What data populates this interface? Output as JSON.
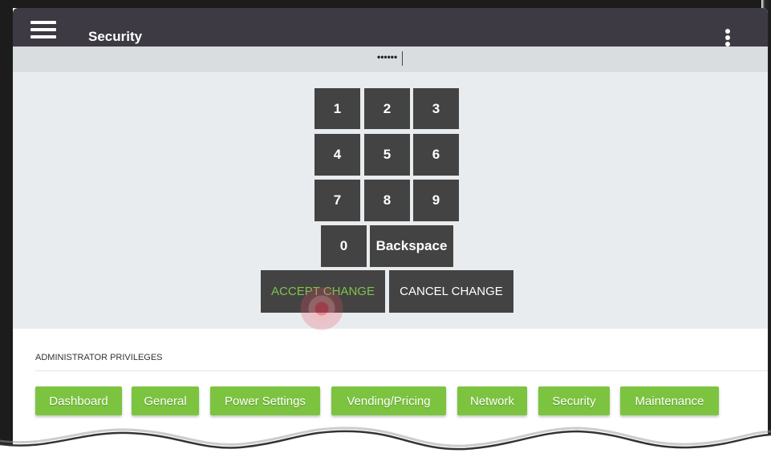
{
  "header": {
    "title": "Security",
    "menu_icon": "hamburger-icon",
    "more_icon": "kebab-menu-icon"
  },
  "pin_entry": {
    "masked_value": "••••••"
  },
  "keypad": {
    "keys": [
      "1",
      "2",
      "3",
      "4",
      "5",
      "6",
      "7",
      "8",
      "9",
      "0"
    ],
    "backspace_label": "Backspace",
    "accept_label": "ACCEPT CHANGE",
    "cancel_label": "CANCEL CHANGE"
  },
  "admin": {
    "section_label": "ADMINISTRATOR PRIVILEGES",
    "tabs": [
      "Dashboard",
      "General",
      "Power Settings",
      "Vending/Pricing",
      "Network",
      "Security",
      "Maintenance"
    ]
  },
  "colors": {
    "topbar": "#3d3a43",
    "key": "#434343",
    "accent_green": "#7cc43f",
    "accept_text": "#7fc44a"
  }
}
